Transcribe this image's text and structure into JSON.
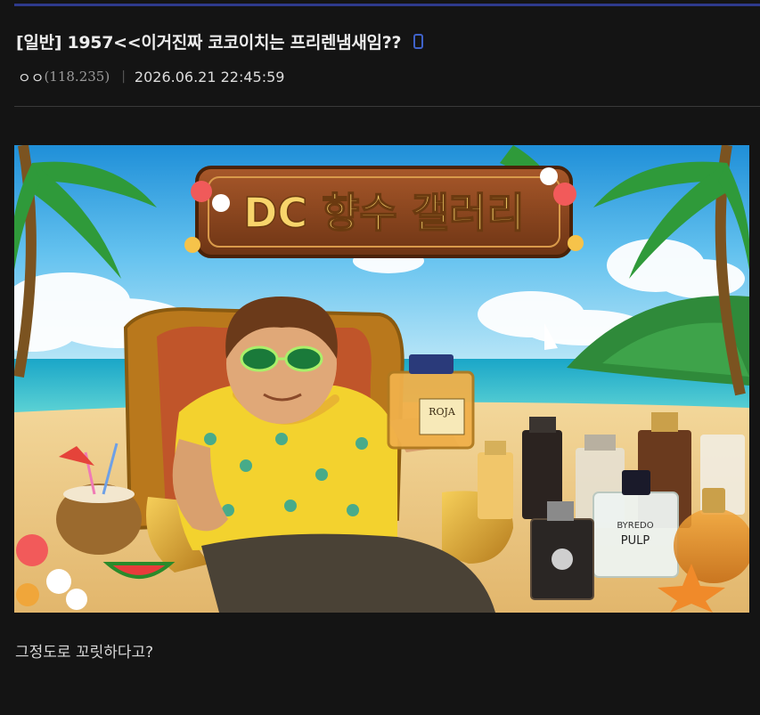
{
  "post": {
    "category": "[일반]",
    "title": "1957<<이거진짜 코코이치는 프리렌냄새임??",
    "author": "ㅇㅇ",
    "ip": "(118.235)",
    "separator": "|",
    "date": "2026.06.21 22:45:59",
    "body_text": "그정도로 꼬릿하다고?"
  },
  "image": {
    "banner_text": "DC 향수 갤러리",
    "bottle_labels": {
      "roja": "ROJA",
      "byredo": "BYREDO",
      "pulp": "PULP"
    }
  },
  "colors": {
    "background": "#141414",
    "accent_rule": "#2e3a8c",
    "mobile_icon": "#3f62c9"
  },
  "icons": {
    "title_suffix": "mobile-phone-icon"
  }
}
